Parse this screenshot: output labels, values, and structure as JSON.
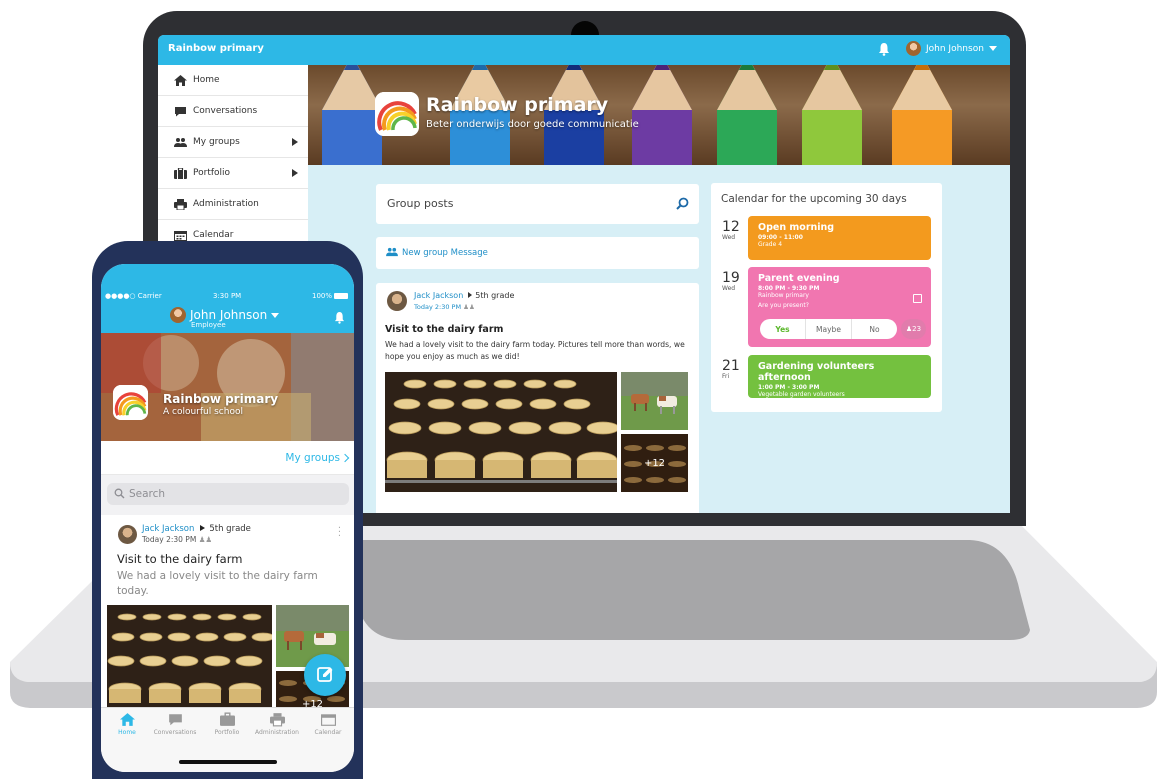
{
  "colors": {
    "accent": "#2db8e6",
    "orange": "#f39a1e",
    "pink": "#f176b0",
    "green": "#74c13f"
  },
  "desktop": {
    "app_name": "Rainbow primary",
    "user_name": "John Johnson",
    "sidebar": {
      "items": [
        {
          "label": "Home",
          "icon": "home-icon"
        },
        {
          "label": "Conversations",
          "icon": "chat-bubble-icon"
        },
        {
          "label": "My groups",
          "icon": "people-icon"
        },
        {
          "label": "Portfolio",
          "icon": "briefcase-icon"
        },
        {
          "label": "Administration",
          "icon": "printer-icon"
        },
        {
          "label": "Calendar",
          "icon": "calendar-icon"
        }
      ]
    },
    "banner": {
      "title": "Rainbow primary",
      "subtitle": "Beter onderwijs door goede communicatie"
    },
    "group_posts_label": "Group posts",
    "new_group_message_label": "New group Message",
    "post": {
      "author": "Jack Jackson",
      "group": "5th grade",
      "time": "Today 2:30 PM",
      "title": "Visit to the dairy farm",
      "body": "We had a lovely visit to the dairy farm today. Pictures tell more than words, we hope you enjoy as much as we did!",
      "more_photos": "+12"
    },
    "calendar": {
      "title": "Calendar for the upcoming 30 days",
      "events": [
        {
          "day": "12",
          "weekday": "Wed",
          "name": "Open morning",
          "time": "09:00 - 11:00",
          "detail": "Grade 4"
        },
        {
          "day": "19",
          "weekday": "Wed",
          "name": "Parent evening",
          "time": "8:00 PM - 9:30 PM",
          "detail": "Rainbow primary",
          "question": "Are you present?",
          "options": [
            "Yes",
            "Maybe",
            "No"
          ],
          "attendees": "23"
        },
        {
          "day": "21",
          "weekday": "Fri",
          "name": "Gardening volunteers afternoon",
          "time": "1:00 PM - 3:00 PM",
          "detail": "Vegetable garden volunteers"
        }
      ]
    }
  },
  "mobile": {
    "status": {
      "carrier": "●●●●○ Carrier",
      "clock": "3:30 PM",
      "battery": "100%"
    },
    "user_name": "John Johnson",
    "user_role": "Employee",
    "banner": {
      "title": "Rainbow primary",
      "subtitle": "A colourful school"
    },
    "my_groups_label": "My groups",
    "search_placeholder": "Search",
    "post": {
      "author": "Jack Jackson",
      "group": "5th grade",
      "time": "Today 2:30 PM",
      "title": "Visit to the dairy farm",
      "body": "We had a lovely visit to the dairy farm today.",
      "more_photos": "+12"
    },
    "tabs": [
      {
        "label": "Home",
        "icon": "home-icon"
      },
      {
        "label": "Conversations",
        "icon": "chat-bubble-icon"
      },
      {
        "label": "Portfolio",
        "icon": "briefcase-icon"
      },
      {
        "label": "Administration",
        "icon": "printer-icon"
      },
      {
        "label": "Calendar",
        "icon": "calendar-icon"
      }
    ]
  }
}
